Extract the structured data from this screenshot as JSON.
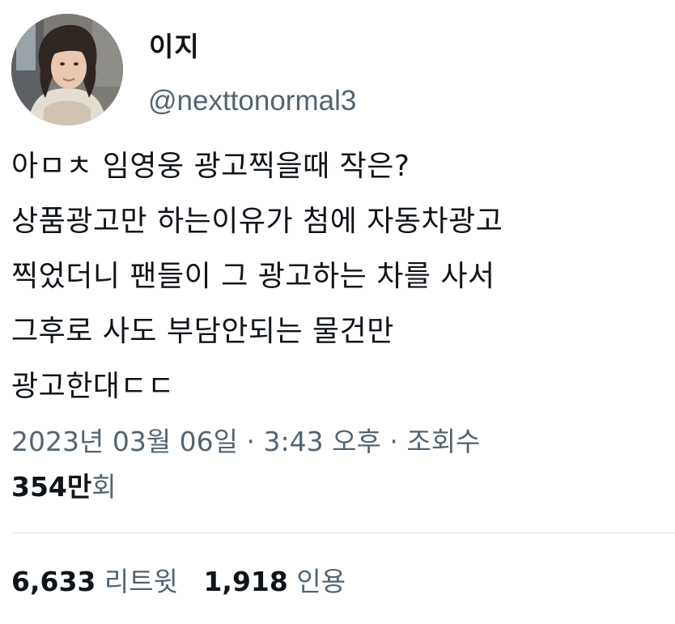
{
  "author": {
    "display_name": "이지",
    "handle": "@nexttonormal3",
    "avatar_icon": "profile-photo"
  },
  "tweet": {
    "lines": [
      "아ㅁㅊ 임영웅 광고찍을때 작은?",
      "상품광고만 하는이유가 첨에 자동차광고",
      "찍었더니 팬들이 그 광고하는 차를 사서",
      "그후로 사도 부담안되는 물건만",
      "광고한대ㄷㄷ"
    ]
  },
  "meta": {
    "date": "2023년 03월 06일",
    "separator": " · ",
    "time": "3:43 오후",
    "views_label": "조회수",
    "views_count": "354만",
    "views_suffix": "회"
  },
  "stats": {
    "retweets_count": "6,633",
    "retweets_label": "리트윗",
    "quotes_count": "1,918",
    "quotes_label": "인용"
  },
  "colors": {
    "text_primary": "#0f1419",
    "text_secondary": "#536471",
    "divider": "#dfe3e6",
    "background": "#ffffff"
  }
}
